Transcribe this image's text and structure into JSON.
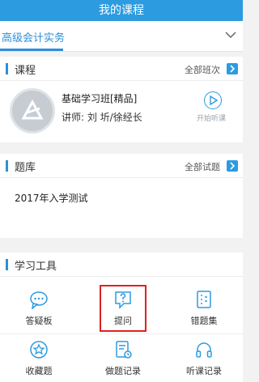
{
  "header": {
    "title": "我的课程"
  },
  "course_select": {
    "selected": "高级会计实务"
  },
  "course_section": {
    "title": "课程",
    "more_label": "全部班次",
    "course": {
      "name": "基础学习班[精品]",
      "teacher": "讲师:  刘   圻/徐经长",
      "action_label": "开始听课"
    }
  },
  "exam_section": {
    "title": "题库",
    "more_label": "全部试题",
    "items": [
      "2017年入学测试"
    ]
  },
  "tools_section": {
    "title": "学习工具",
    "tools": [
      {
        "label": "答疑板",
        "icon": "chat-icon"
      },
      {
        "label": "提问",
        "icon": "question-icon"
      },
      {
        "label": "错题集",
        "icon": "notebook-icon"
      },
      {
        "label": "收藏题",
        "icon": "star-icon"
      },
      {
        "label": "做题记录",
        "icon": "exam-record-icon"
      },
      {
        "label": "听课记录",
        "icon": "headphones-icon"
      }
    ]
  },
  "colors": {
    "accent": "#2c9be0",
    "highlight": "#e02020"
  }
}
